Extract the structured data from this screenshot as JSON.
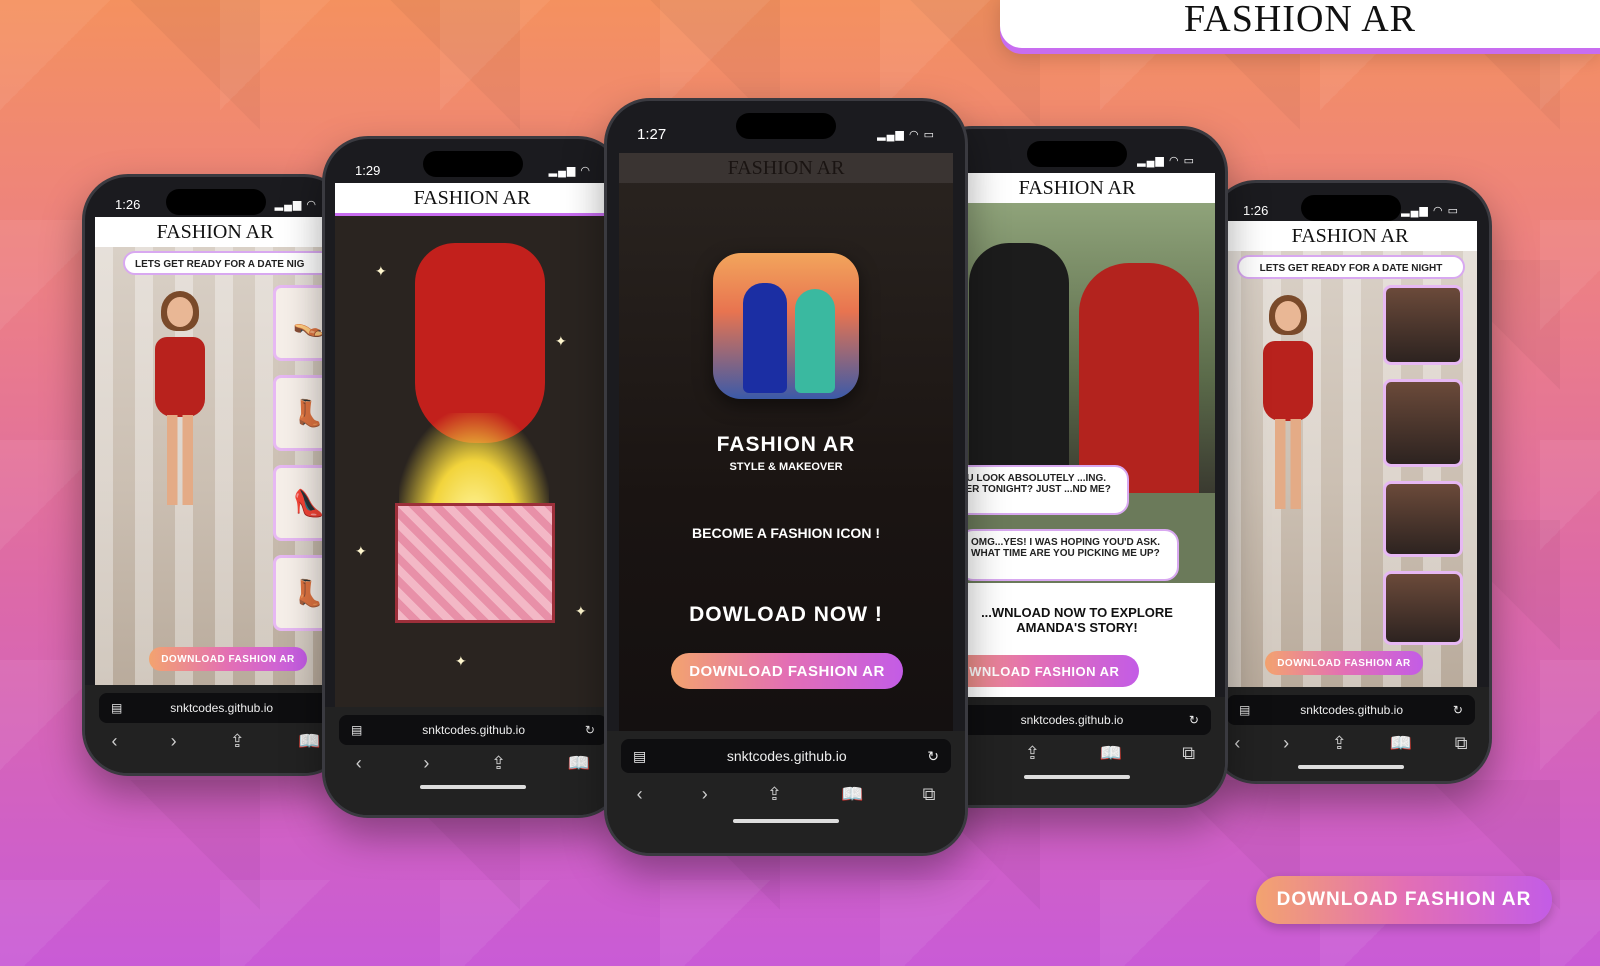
{
  "brand": {
    "title": "FASHION AR"
  },
  "cta": {
    "label": "DOWNLOAD FASHION AR"
  },
  "phones": {
    "p1": {
      "time": "1:26",
      "app_title": "FASHION AR",
      "speech": "LETS GET READY FOR A DATE NIG",
      "thumbs": [
        "👡",
        "👢",
        "👠",
        "👢"
      ],
      "button": "DOWNLOAD FASHION AR",
      "url": "snktcodes.github.io"
    },
    "p2": {
      "time": "1:29",
      "app_title": "FASHION AR",
      "url": "snktcodes.github.io"
    },
    "p3": {
      "time": "1:27",
      "app_title": "FASHION AR",
      "heading": "FASHION AR",
      "subheading": "STYLE & MAKEOVER",
      "tagline": "BECOME A FASHION ICON !",
      "download_now": "DOWLOAD NOW !",
      "button": "DOWNLOAD FASHION AR",
      "url": "snktcodes.github.io"
    },
    "p4": {
      "app_title": "FASHION AR",
      "chat1": "... YOU LOOK ABSOLUTELY ...ING. DINNER TONIGHT? JUST ...ND ME?",
      "chat2": "OMG...YES! I WAS HOPING YOU'D ASK. WHAT TIME ARE YOU PICKING ME UP?",
      "explore": "...WNLOAD NOW TO EXPLORE AMANDA'S STORY!",
      "button": "DOWNLOAD FASHION AR",
      "url": "snktcodes.github.io"
    },
    "p5": {
      "time": "1:26",
      "app_title": "FASHION AR",
      "speech": "LETS GET READY FOR A DATE NIGHT",
      "button": "DOWNLOAD FASHION AR",
      "url": "snktcodes.github.io"
    }
  },
  "icons": {
    "back": "‹",
    "forward": "›",
    "share": "⇪",
    "bookmarks": "📖",
    "tabs": "⧉",
    "reload": "↻",
    "page": "▤"
  }
}
